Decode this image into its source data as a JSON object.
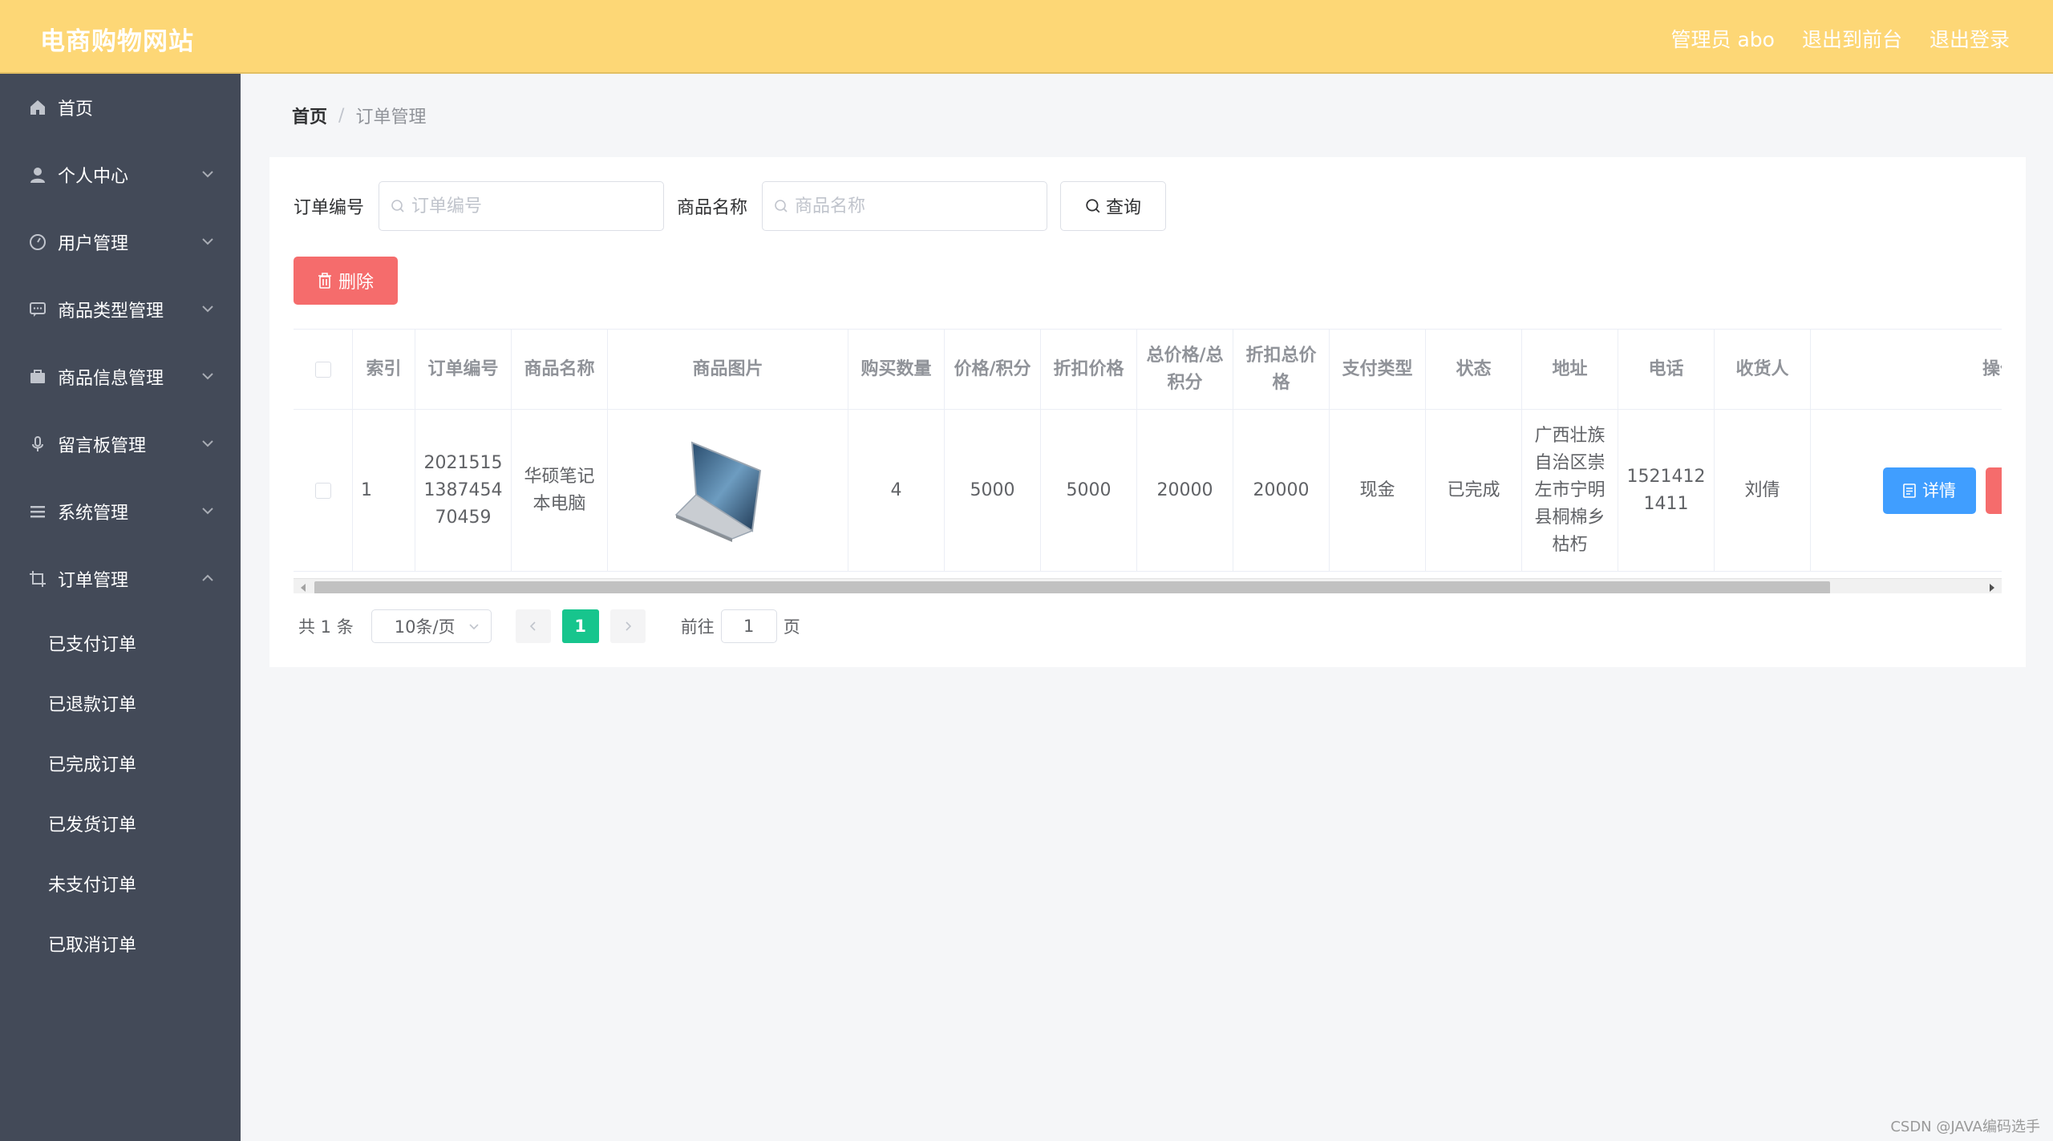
{
  "header": {
    "site_title": "电商购物网站",
    "admin_label": "管理员 abo",
    "to_frontend": "退出到前台",
    "logout": "退出登录"
  },
  "sidebar": {
    "items": [
      {
        "label": "首页",
        "icon": "home-icon"
      },
      {
        "label": "个人中心",
        "icon": "user-icon"
      },
      {
        "label": "用户管理",
        "icon": "gauge-icon"
      },
      {
        "label": "商品类型管理",
        "icon": "chat-icon"
      },
      {
        "label": "商品信息管理",
        "icon": "briefcase-icon"
      },
      {
        "label": "留言板管理",
        "icon": "microphone-icon"
      },
      {
        "label": "系统管理",
        "icon": "menu-icon"
      },
      {
        "label": "订单管理",
        "icon": "crop-icon"
      }
    ],
    "sub_items": [
      "已支付订单",
      "已退款订单",
      "已完成订单",
      "已发货订单",
      "未支付订单",
      "已取消订单"
    ]
  },
  "breadcrumb": {
    "home": "首页",
    "separator": "/",
    "current": "订单管理"
  },
  "search": {
    "order_label": "订单编号",
    "order_placeholder": "订单编号",
    "product_label": "商品名称",
    "product_placeholder": "商品名称",
    "query_button": "查询"
  },
  "toolbar": {
    "delete_button": "删除"
  },
  "table": {
    "headers": {
      "index": "索引",
      "order_no": "订单编号",
      "product_name": "商品名称",
      "product_image": "商品图片",
      "quantity": "购买数量",
      "price": "价格/积分",
      "discount_price": "折扣价格",
      "total": "总价格/总积分",
      "discount_total": "折扣总价格",
      "pay_type": "支付类型",
      "status": "状态",
      "address": "地址",
      "phone": "电话",
      "receiver": "收货人",
      "actions": "操作"
    },
    "rows": [
      {
        "index": "1",
        "order_no": "20215151387454 70459",
        "product_name": "华硕笔记本电脑",
        "quantity": "4",
        "price": "5000",
        "discount_price": "5000",
        "total": "20000",
        "discount_total": "20000",
        "pay_type": "现金",
        "status": "已完成",
        "address": "广西壮族自治区崇左市宁明县桐棉乡枯朽",
        "phone": "15214121411",
        "receiver": "刘倩",
        "detail_button": "详情"
      }
    ]
  },
  "pagination": {
    "total_text": "共 1 条",
    "page_size": "10条/页",
    "current_page": "1",
    "goto_label": "前往",
    "goto_value": "1",
    "page_suffix": "页"
  },
  "watermark": "CSDN @JAVA编码选手",
  "colors": {
    "header_bg": "#fdd776",
    "sidebar_bg": "#434a58",
    "danger": "#f56c6c",
    "primary": "#409eff",
    "page_active": "#17c58d"
  }
}
